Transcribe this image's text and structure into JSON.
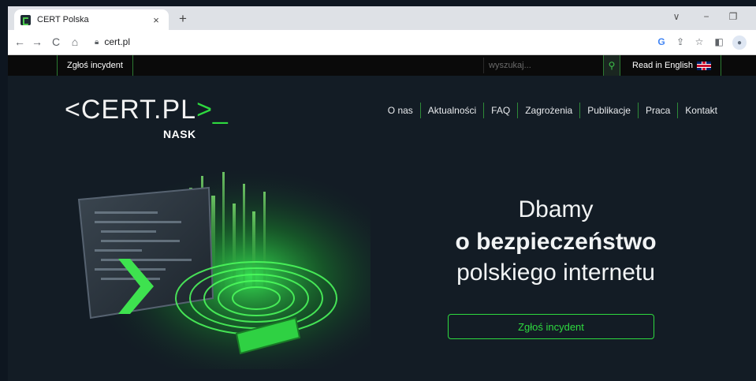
{
  "browser": {
    "tab_title": "CERT Polska",
    "tab_close": "×",
    "new_tab": "+",
    "url": "cert.pl",
    "window_controls": {
      "dropdown": "∨",
      "minimize": "−",
      "restore": "❐"
    },
    "icons": [
      "back-icon",
      "forward-icon",
      "reload-icon",
      "home-icon",
      "lock-icon",
      "google-icon",
      "share-icon",
      "star-icon",
      "sidepanel-icon",
      "profile-icon"
    ]
  },
  "topbar": {
    "report_label": "Zgłoś incydent",
    "search_placeholder": "wyszukaj...",
    "language_label": "Read in English"
  },
  "logo": {
    "main": "CERT.PL",
    "accent": ">_",
    "sub": "NASK"
  },
  "nav": {
    "items": [
      "O nas",
      "Aktualności",
      "FAQ",
      "Zagrożenia",
      "Publikacje",
      "Praca",
      "Kontakt"
    ]
  },
  "hero": {
    "line1": "Dbamy",
    "line2": "o bezpieczeństwo",
    "line3": "polskiego internetu",
    "cta_label": "Zgłoś incydent"
  },
  "colors": {
    "accent_green": "#2ed93f",
    "page_background": "#131c25",
    "topbar_background": "#0a0a0a"
  }
}
